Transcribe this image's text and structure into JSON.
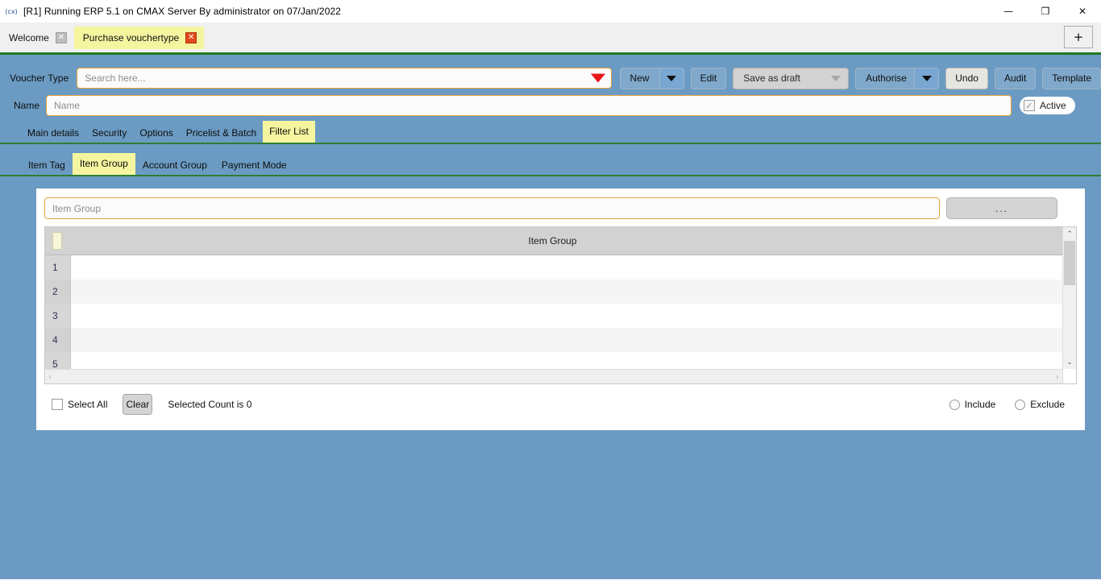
{
  "window": {
    "title": "[R1] Running ERP 5.1 on CMAX Server By administrator on 07/Jan/2022",
    "app_glyph": "(cx)",
    "minimize": "—",
    "maximize": "❐",
    "close": "✕"
  },
  "tabstrip": {
    "tabs": [
      {
        "label": "Welcome",
        "close": "✕",
        "active": false
      },
      {
        "label": "Purchase vouchertype",
        "close": "✕",
        "active": true
      }
    ],
    "new_tab": "+"
  },
  "toolbar": {
    "voucher_type_label": "Voucher Type",
    "search_placeholder": "Search here...",
    "search_value": "",
    "new_label": "New",
    "edit_label": "Edit",
    "save_as_draft_label": "Save as draft",
    "authorise_label": "Authorise",
    "undo_label": "Undo",
    "audit_label": "Audit",
    "template_label": "Template"
  },
  "name_row": {
    "label": "Name",
    "placeholder": "Name",
    "value": "",
    "active_label": "Active",
    "active_checked": true,
    "check_glyph": "✓"
  },
  "main_tabs": [
    {
      "label": "Main details",
      "active": false
    },
    {
      "label": "Security",
      "active": false
    },
    {
      "label": "Options",
      "active": false
    },
    {
      "label": "Pricelist & Batch",
      "active": false
    },
    {
      "label": "Filter List",
      "active": true
    }
  ],
  "sub_tabs": [
    {
      "label": "Item Tag",
      "active": false
    },
    {
      "label": "Item Group",
      "active": true
    },
    {
      "label": "Account Group",
      "active": false
    },
    {
      "label": "Payment Mode",
      "active": false
    }
  ],
  "panel": {
    "item_group_placeholder": "Item Group",
    "item_group_value": "",
    "browse_label": "...",
    "grid": {
      "column_header": "Item Group",
      "rows": [
        {
          "num": "1",
          "value": ""
        },
        {
          "num": "2",
          "value": ""
        },
        {
          "num": "3",
          "value": ""
        },
        {
          "num": "4",
          "value": ""
        },
        {
          "num": "5",
          "value": ""
        }
      ],
      "scroll_up": "⌃",
      "scroll_down": "⌄",
      "scroll_left": "‹",
      "scroll_right": "›"
    },
    "footer": {
      "select_all_label": "Select All",
      "select_all_checked": false,
      "clear_label": "Clear",
      "selected_count_text": "Selected Count is 0",
      "include_label": "Include",
      "include_selected": false,
      "exclude_label": "Exclude",
      "exclude_selected": false
    }
  },
  "colors": {
    "app_background": "#6b9bc3",
    "active_tab": "#f5f5a0",
    "accent_border": "#e8a33d",
    "green_rule": "#2f7d32",
    "red_caret": "#e8161a"
  }
}
